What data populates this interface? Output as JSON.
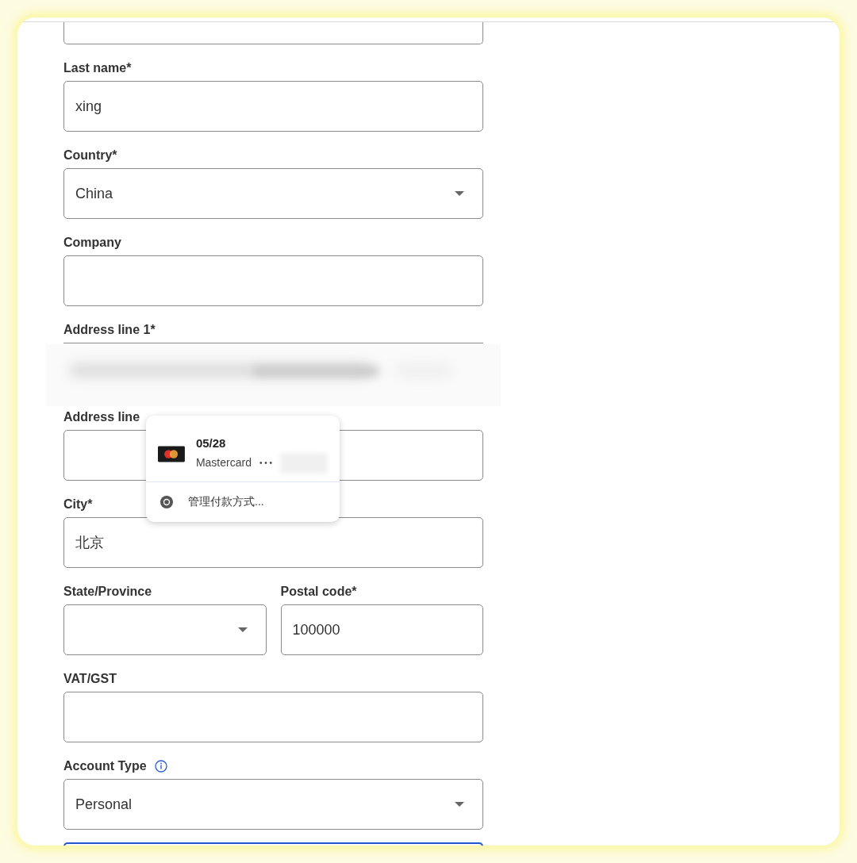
{
  "rows": [
    [
      {
        "kind": "text",
        "label": "Last name*",
        "value": "xing"
      }
    ],
    [
      {
        "kind": "select",
        "label": "Country*",
        "value": "China"
      }
    ],
    [
      {
        "kind": "text",
        "label": "Company"
      }
    ],
    [
      {
        "label": "Address line 1*",
        "blurred": true
      }
    ],
    [
      {
        "kind": "text",
        "label": "Address line"
      }
    ],
    [
      {
        "kind": "text",
        "label": "City*",
        "value": "北京"
      }
    ],
    [
      {
        "kind": "select",
        "label": "State/Province"
      },
      {
        "kind": "text",
        "label": "Postal code*",
        "value": "100000"
      }
    ],
    [
      {
        "kind": "text",
        "label": "VAT/GST"
      }
    ],
    [
      {
        "kind": "select",
        "label": "Account Type",
        "info": true,
        "value": "Personal"
      }
    ]
  ],
  "autofill": {
    "expiry": "05/28",
    "brand": "Mastercard",
    "number": "• • •",
    "manage": "管理付款方式..."
  }
}
